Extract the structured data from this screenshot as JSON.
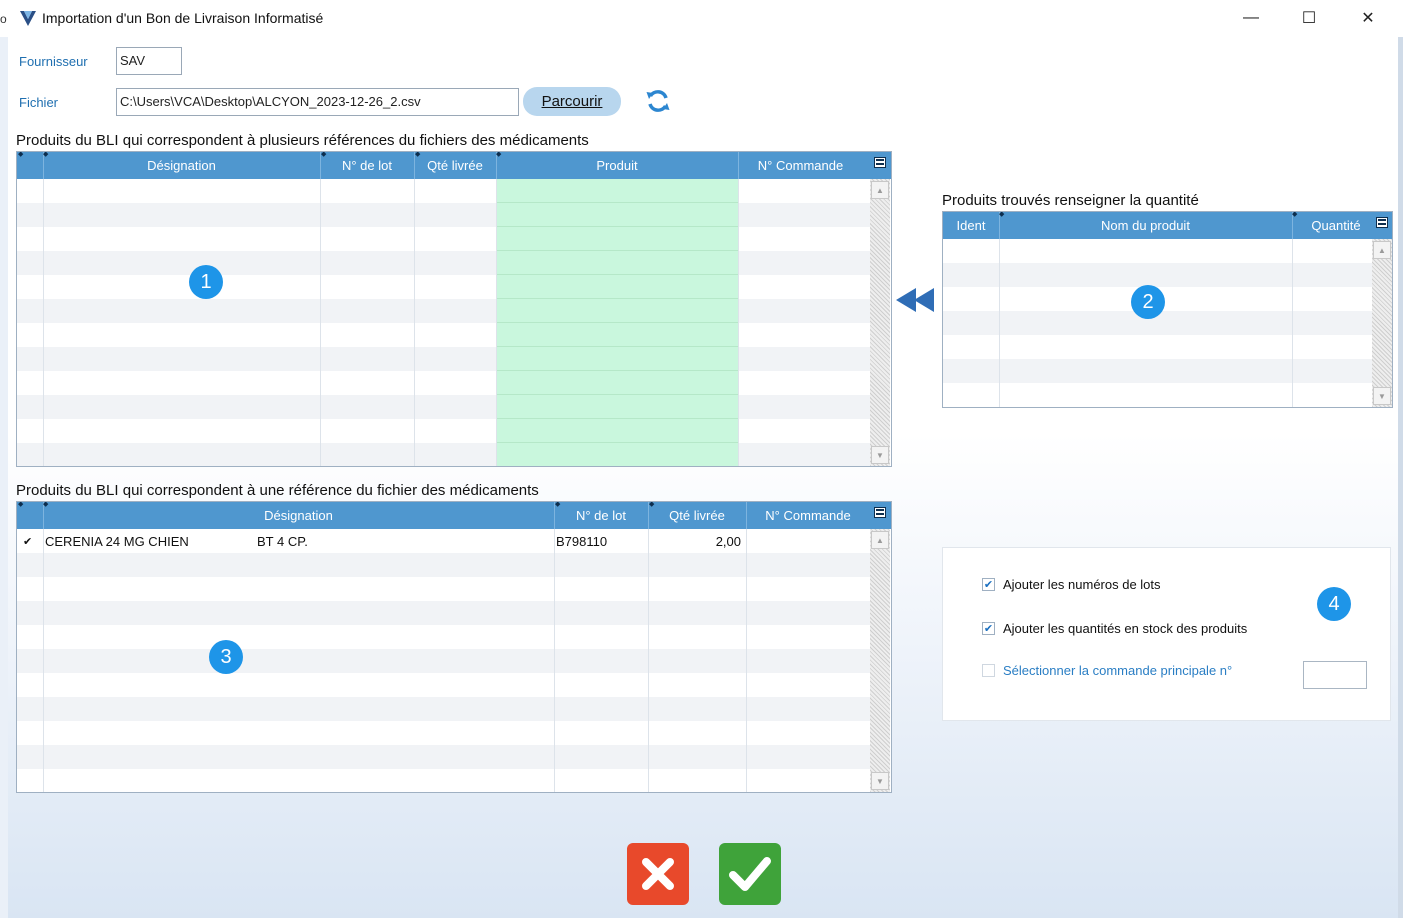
{
  "window": {
    "title": "Importation d'un Bon de Livraison Informatisé",
    "edge_glyph": "o",
    "controls": {
      "minimize": "—",
      "maximize": "☐",
      "close": "✕"
    }
  },
  "form": {
    "supplier_label": "Fournisseur",
    "supplier_value": "SAV",
    "file_label": "Fichier",
    "file_value": "C:\\Users\\VCA\\Desktop\\ALCYON_2023-12-26_2.csv",
    "browse_label": "Parcourir",
    "refresh_icon": "refresh-icon"
  },
  "grid_multi": {
    "title": "Produits du BLI qui correspondent à plusieurs références du fichiers des médicaments",
    "columns": [
      "Désignation",
      "N° de lot",
      "Qté livrée",
      "Produit",
      "N° Commande"
    ],
    "highlight_color": "#c9f7dd",
    "badge": "1"
  },
  "grid_found": {
    "title": "Produits trouvés renseigner la quantité",
    "columns": [
      "Ident",
      "Nom du produit",
      "Quantité"
    ],
    "badge": "2"
  },
  "transfer_icon": "double-left-arrow-icon",
  "grid_single": {
    "title": "Produits du BLI qui correspondent à une référence du fichier des médicaments",
    "columns": [
      "Désignation",
      "N° de lot",
      "Qté livrée",
      "N° Commande"
    ],
    "rows": [
      {
        "checked": "✔",
        "designation": "CERENIA 24 MG CHIEN",
        "packaging": "BT 4 CP.",
        "lot": "B798110",
        "qty": "2,00",
        "order": ""
      }
    ],
    "badge": "3"
  },
  "options": {
    "badge": "4",
    "items": [
      {
        "label": "Ajouter les numéros de lots",
        "checked": true
      },
      {
        "label": "Ajouter les quantités en stock des produits",
        "checked": true
      },
      {
        "label": "Sélectionner la commande principale n°",
        "checked": false
      }
    ],
    "order_input_value": ""
  },
  "actions": {
    "cancel_color": "#e8492b",
    "validate_color": "#3fa33a"
  }
}
